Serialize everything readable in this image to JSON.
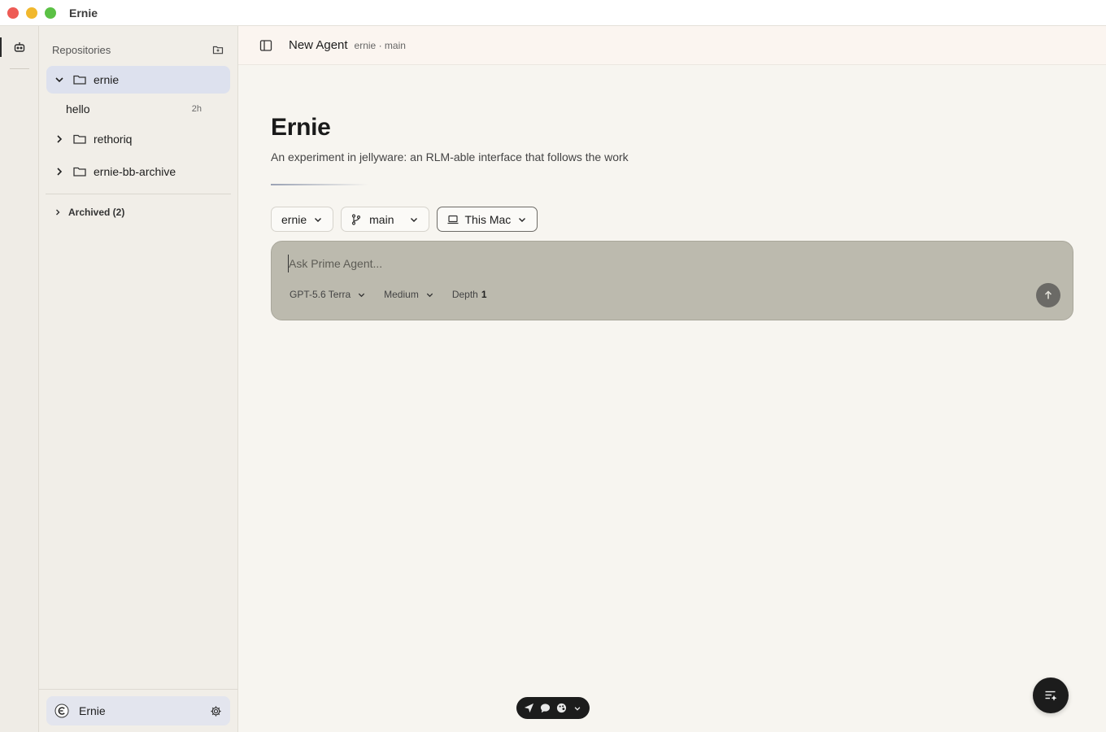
{
  "window": {
    "title": "Ernie"
  },
  "sidebar": {
    "header": "Repositories",
    "repos": [
      {
        "name": "ernie",
        "expanded": true,
        "sessions": [
          {
            "name": "hello",
            "time": "2h"
          }
        ]
      },
      {
        "name": "rethoriq",
        "expanded": false
      },
      {
        "name": "ernie-bb-archive",
        "expanded": false
      }
    ],
    "archived_label": "Archived (2)",
    "user": {
      "name": "Ernie"
    }
  },
  "topbar": {
    "title": "New Agent",
    "context": "ernie · main"
  },
  "hero": {
    "title": "Ernie",
    "subtitle": "An experiment in jellyware: an RLM-able interface that follows the work"
  },
  "selectors": {
    "repo": "ernie",
    "branch": "main",
    "machine": "This Mac"
  },
  "composer": {
    "placeholder": "Ask Prime Agent...",
    "model": "GPT-5.6 Terra",
    "effort": "Medium",
    "depth_label": "Depth",
    "depth_value": "1"
  },
  "icons": {
    "rail": "robot-icon",
    "new_repo": "folder-plus-icon",
    "panel_toggle": "sidebar-toggle-icon",
    "send": "arrow-up-icon",
    "settings": "gear-icon",
    "fab": "list-sparkle-icon",
    "toolbar": [
      "send-icon",
      "chat-bubble-icon",
      "palette-icon",
      "chevron-down-icon"
    ]
  },
  "colors": {
    "composer_bg": "#bcbaae",
    "active_repo_bg": "#dde1ee",
    "dark": "#1c1c1c"
  }
}
